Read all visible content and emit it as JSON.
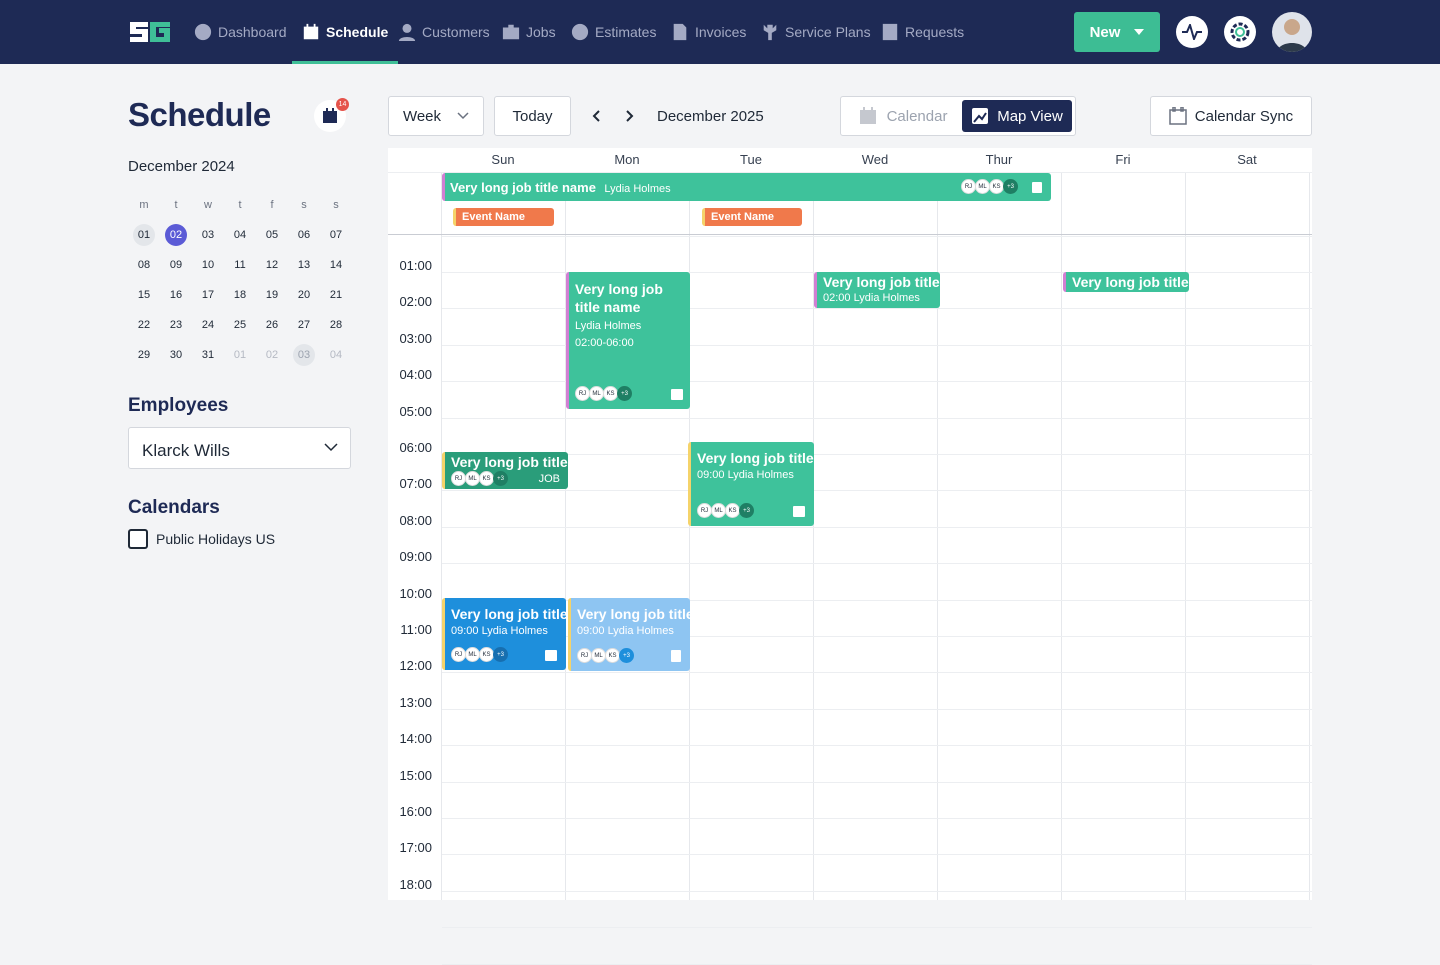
{
  "nav": {
    "items": [
      {
        "label": "Dashboard",
        "icon": "dashboard-icon"
      },
      {
        "label": "Schedule",
        "icon": "calendar-icon",
        "active": true
      },
      {
        "label": "Customers",
        "icon": "user-icon"
      },
      {
        "label": "Jobs",
        "icon": "briefcase-icon"
      },
      {
        "label": "Estimates",
        "icon": "estimate-icon"
      },
      {
        "label": "Invoices",
        "icon": "invoice-icon"
      },
      {
        "label": "Service Plans",
        "icon": "wrench-icon"
      },
      {
        "label": "Requests",
        "icon": "list-icon"
      }
    ],
    "new_label": "New"
  },
  "sidebar": {
    "title": "Schedule",
    "badge_count": "14",
    "mini_month": "December 2024",
    "weekdays": [
      "m",
      "t",
      "w",
      "t",
      "f",
      "s",
      "s"
    ],
    "weeks": [
      [
        "01",
        "02",
        "03",
        "04",
        "05",
        "06",
        "07"
      ],
      [
        "08",
        "09",
        "10",
        "11",
        "12",
        "13",
        "14"
      ],
      [
        "15",
        "16",
        "17",
        "18",
        "19",
        "20",
        "21"
      ],
      [
        "22",
        "23",
        "24",
        "25",
        "26",
        "27",
        "28"
      ],
      [
        "29",
        "30",
        "31",
        "01",
        "02",
        "03",
        "04"
      ]
    ],
    "employees_heading": "Employees",
    "employee_selected": "Klarck Wills",
    "calendars_heading": "Calendars",
    "calendar_option": "Public Holidays US"
  },
  "toolbar": {
    "view_label": "Week",
    "today_label": "Today",
    "current_range": "December 2025",
    "calendar_tab": "Calendar",
    "map_tab": "Map View",
    "sync_label": "Calendar Sync"
  },
  "calendar": {
    "days": [
      "Sun",
      "Mon",
      "Tue",
      "Wed",
      "Thur",
      "Fri",
      "Sat"
    ],
    "hours": [
      "01:00",
      "02:00",
      "03:00",
      "04:00",
      "05:00",
      "06:00",
      "07:00",
      "08:00",
      "09:00",
      "10:00",
      "11:00",
      "12:00",
      "13:00",
      "14:00",
      "15:00",
      "16:00",
      "17:00",
      "18:00"
    ],
    "allday": {
      "title": "Very long job title name",
      "person": "Lydia Holmes"
    },
    "event_name": "Event Name",
    "chips": [
      "RJ",
      "ML",
      "KS",
      "+3"
    ],
    "job_tag": "JOB",
    "ev_title": "Very long job title name",
    "ev_title_short": "Very long job title na",
    "ev_title_cut": "Very long job title n",
    "person": "Lydia Holmes",
    "t1": "02:00-06:00",
    "t2": "02:00 Lydia Holmes",
    "t3": "09:00 Lydia Holmes"
  }
}
